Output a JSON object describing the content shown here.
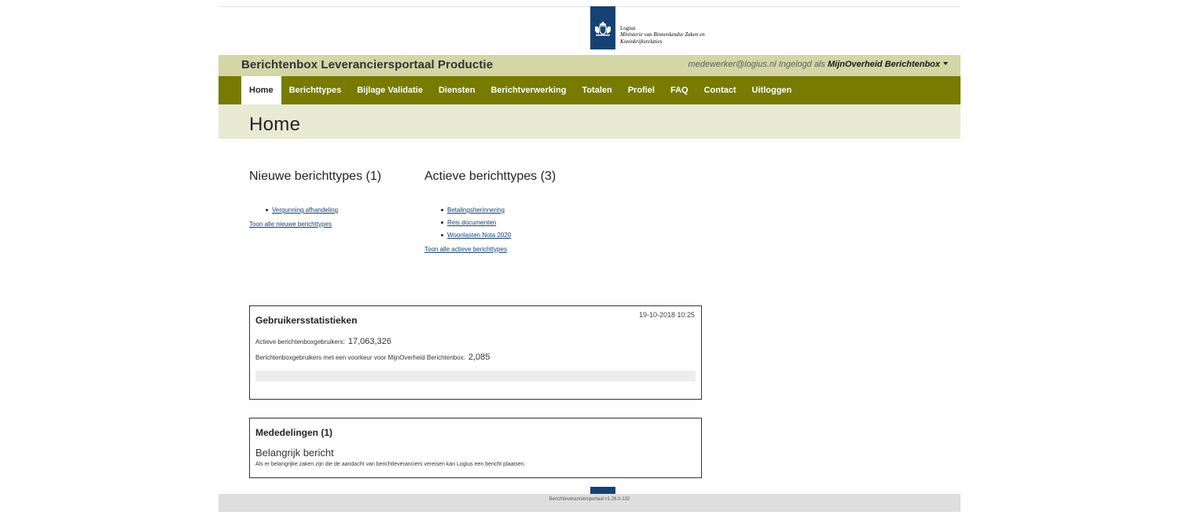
{
  "logo": {
    "organisation": "Logius",
    "ministry_line1": "Ministerie van Binnenlandse Zaken en",
    "ministry_line2": "Koninkrijksrelaties"
  },
  "header": {
    "app_title": "Berichtenbox Leveranciersportaal Productie",
    "user_email": "medewerker@logius.nl",
    "logged_in_as": "Ingelogd als",
    "organisation": "MijnOverheid Berichtenbox"
  },
  "nav": {
    "items": [
      "Home",
      "Berichttypes",
      "Bijlage Validatie",
      "Diensten",
      "Berichtverwerking",
      "Totalen",
      "Profiel",
      "FAQ",
      "Contact",
      "Uitloggen"
    ],
    "active": "Home"
  },
  "page_title": "Home",
  "new_types": {
    "heading": "Nieuwe berichttypes (1)",
    "items": [
      "Vergunning afhandeling"
    ],
    "show_all": "Toon alle nieuwe berichttypes"
  },
  "active_types": {
    "heading": "Actieve berichttypes (3)",
    "items": [
      "Betalingsherinnering",
      "Reis documenten",
      "Woonlasten Nota 2020"
    ],
    "show_all": "Toon alle actieve berichttypes"
  },
  "stats": {
    "title": "Gebruikersstatistieken",
    "timestamp": "19-10-2018 10:25",
    "active_label": "Actieve berichtenboxgebruikers:",
    "active_value": "17,063,326",
    "pref_label": "Berichtenboxgebruikers met een voorkeur voor MijnOverheid Berichtenbox:",
    "pref_value": "2,085"
  },
  "notices": {
    "title": "Mededelingen (1)",
    "message_title": "Belangrijk bericht",
    "message_body": "Als er belangrijke zaken zijn die de aandacht van berichtleveranciers vereisen kan Logius een bericht plaatsen."
  },
  "footer": {
    "version": "Berichtleveranciersportaal v1.26.0-132"
  },
  "colors": {
    "nav_bg": "#777b00",
    "titlebar_bg": "#d3d6a5",
    "headband_bg": "#e9ead4",
    "logo_blue": "#154273",
    "link": "#154273"
  }
}
